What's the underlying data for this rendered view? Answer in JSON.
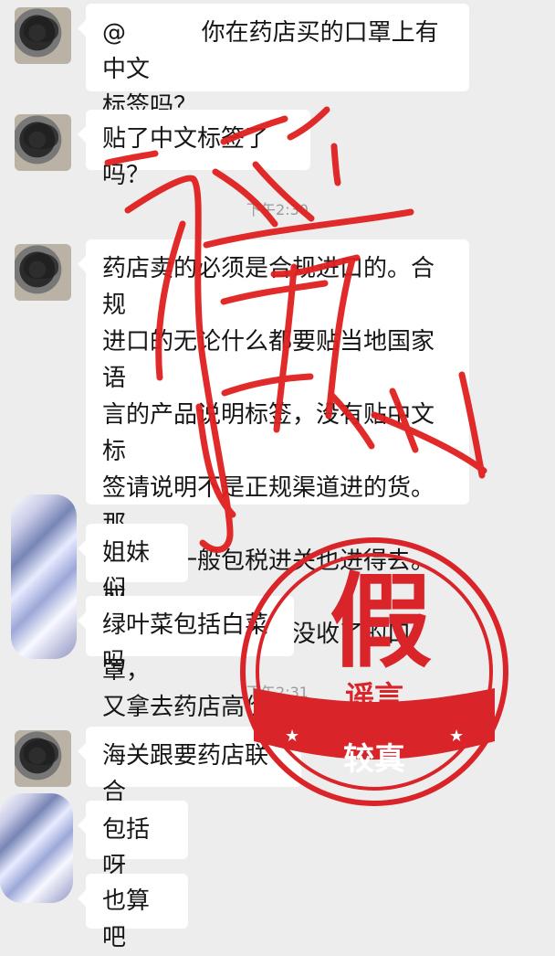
{
  "messages": [
    {
      "text": "@          你在药店买的口罩上有中文\n标签吗？"
    },
    {
      "text": "贴了中文标签了吗？"
    },
    {
      "text": "药店卖的必须是合规进口的。合规\n进口的无论什么都要贴当地国家语\n言的产品说明标签，没有贴中文标\n签请说明不是正规渠道进的货。那\n就说明一般包税进关也进得去。或\n者说，是海关扣下没收了的口罩，\n又拿去药店高价卖。"
    },
    {
      "text": "姐妹们"
    },
    {
      "text": "绿叶菜包括白菜吗"
    },
    {
      "text": "海关跟要药店联合"
    },
    {
      "text": "包括呀"
    },
    {
      "text": "也算吧"
    }
  ],
  "timestamps": [
    "下午2:30",
    "下午2:31"
  ],
  "overlay": {
    "handwritten_mark": "谣",
    "stamp_main": "假",
    "stamp_sub": "谣言",
    "stamp_bottom": "较真"
  },
  "colors": {
    "background": "#ededed",
    "bubble": "#ffffff",
    "stamp_red": "#d9252a"
  }
}
